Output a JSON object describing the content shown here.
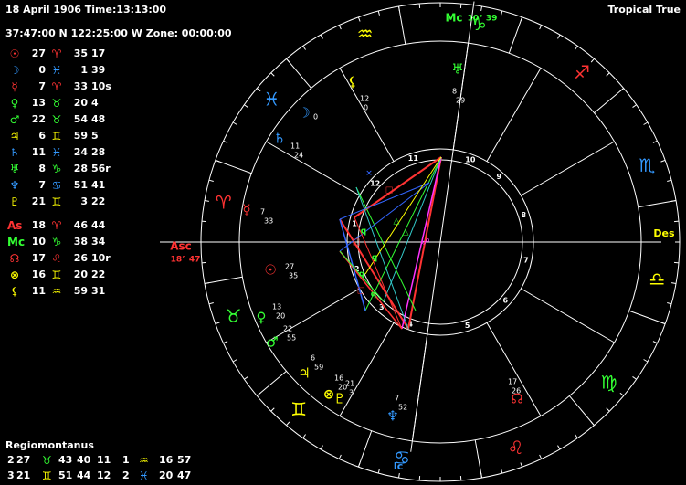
{
  "header": {
    "datetime": "18 April 1906 Time:13:13:00",
    "location": "37:47:00 N 122:25:00 W Zone: 00:00:00",
    "zodiac_mode": "Tropical True"
  },
  "planets": [
    {
      "symbol": "☉",
      "color": "#ff3333",
      "deg": "27",
      "sign": "♈",
      "sign_color": "#ff3333",
      "min": "35",
      "sec": "17"
    },
    {
      "symbol": "☽",
      "color": "#3399ff",
      "deg": "0",
      "sign": "♓",
      "sign_color": "#3399ff",
      "min": "1",
      "sec": "39"
    },
    {
      "symbol": "☿",
      "color": "#ff3333",
      "deg": "7",
      "sign": "♈",
      "sign_color": "#ff3333",
      "min": "33",
      "sec": "10s"
    },
    {
      "symbol": "♀",
      "color": "#33ff33",
      "deg": "13",
      "sign": "♉",
      "sign_color": "#33ff33",
      "min": "20",
      "sec": "4"
    },
    {
      "symbol": "♂",
      "color": "#33ff33",
      "deg": "22",
      "sign": "♉",
      "sign_color": "#33ff33",
      "min": "54",
      "sec": "48"
    },
    {
      "symbol": "♃",
      "color": "#ffff00",
      "deg": "6",
      "sign": "♊",
      "sign_color": "#ffff00",
      "min": "59",
      "sec": "5"
    },
    {
      "symbol": "♄",
      "color": "#3399ff",
      "deg": "11",
      "sign": "♓",
      "sign_color": "#3399ff",
      "min": "24",
      "sec": "28"
    },
    {
      "symbol": "♅",
      "color": "#33ff33",
      "deg": "8",
      "sign": "♑",
      "sign_color": "#33ff33",
      "min": "28",
      "sec": "56r"
    },
    {
      "symbol": "♆",
      "color": "#3399ff",
      "deg": "7",
      "sign": "♋",
      "sign_color": "#3399ff",
      "min": "51",
      "sec": "41"
    },
    {
      "symbol": "♇",
      "color": "#ffff00",
      "deg": "21",
      "sign": "♊",
      "sign_color": "#ffff00",
      "min": "3",
      "sec": "22"
    }
  ],
  "points": [
    {
      "symbol": "As",
      "color": "#ff3333",
      "deg": "18",
      "sign": "♈",
      "sign_color": "#ff3333",
      "min": "46",
      "sec": "44"
    },
    {
      "symbol": "Mc",
      "color": "#33ff33",
      "deg": "10",
      "sign": "♑",
      "sign_color": "#33ff33",
      "min": "38",
      "sec": "34"
    },
    {
      "symbol": "☊",
      "color": "#ff3333",
      "deg": "17",
      "sign": "♌",
      "sign_color": "#ff3333",
      "min": "26",
      "sec": "10r"
    },
    {
      "symbol": "⊗",
      "color": "#ffff00",
      "deg": "16",
      "sign": "♊",
      "sign_color": "#ffff00",
      "min": "20",
      "sec": "22"
    },
    {
      "symbol": "⚸",
      "color": "#ffff00",
      "deg": "11",
      "sign": "♒",
      "sign_color": "#ffff00",
      "min": "59",
      "sec": "31"
    }
  ],
  "houses": {
    "title": "Regiomontanus",
    "rows": [
      {
        "house": "2",
        "deg": "27",
        "sign": "♉",
        "sign_color": "#33ff33",
        "min": "43",
        "sec": "40",
        "house_b": "11",
        "deg_b": "1",
        "sign_b": "♒",
        "sign_b_color": "#ffff00",
        "min_b": "16",
        "sec_b": "57"
      },
      {
        "house": "3",
        "deg": "21",
        "sign": "♊",
        "sign_color": "#ffff00",
        "min": "51",
        "sec": "44",
        "house_b": "12",
        "deg_b": "2",
        "sign_b": "♓",
        "sign_b_color": "#3399ff",
        "min_b": "20",
        "sec_b": "47"
      }
    ]
  },
  "wheel": {
    "angles": {
      "asc": {
        "label": "Asc",
        "pos": "18° 47",
        "color": "#ff3333"
      },
      "mc": {
        "label": "Mc",
        "pos": "10° 39",
        "color": "#33ff33"
      },
      "des": {
        "label": "Des",
        "color": "#ffff00"
      },
      "ic": {
        "label": "Ic",
        "color": "#3399ff"
      }
    },
    "house_numbers": [
      "1",
      "2",
      "3",
      "4",
      "5",
      "6",
      "7",
      "8",
      "9",
      "10",
      "11",
      "12"
    ],
    "signs": [
      {
        "glyph": "♑",
        "color": "#33ff33"
      },
      {
        "glyph": "♒",
        "color": "#ffff00"
      },
      {
        "glyph": "♓",
        "color": "#3399ff"
      },
      {
        "glyph": "♈",
        "color": "#ff3333"
      },
      {
        "glyph": "♉",
        "color": "#33ff33"
      },
      {
        "glyph": "♊",
        "color": "#ffff00"
      },
      {
        "glyph": "♋",
        "color": "#3399ff"
      },
      {
        "glyph": "♌",
        "color": "#ff3333"
      },
      {
        "glyph": "♍",
        "color": "#33ff33"
      },
      {
        "glyph": "♎",
        "color": "#ffff00"
      },
      {
        "glyph": "♏",
        "color": "#3399ff"
      },
      {
        "glyph": "♐",
        "color": "#ff3333"
      }
    ],
    "planet_labels": [
      {
        "glyph": "☉",
        "color": "#ff3333",
        "deg": "27",
        "min": "35"
      },
      {
        "glyph": "☽",
        "color": "#3399ff",
        "deg": "0",
        "min": ""
      },
      {
        "glyph": "☿",
        "color": "#ff3333",
        "deg": "7",
        "min": "33"
      },
      {
        "glyph": "♀",
        "color": "#33ff33",
        "deg": "13",
        "min": "20"
      },
      {
        "glyph": "♂",
        "color": "#33ff33",
        "deg": "22",
        "min": "55"
      },
      {
        "glyph": "♃",
        "color": "#ffff00",
        "deg": "6",
        "min": "59"
      },
      {
        "glyph": "♄",
        "color": "#3399ff",
        "deg": "11",
        "min": "24"
      },
      {
        "glyph": "♅",
        "color": "#33ff33",
        "deg": "8",
        "min": "29"
      },
      {
        "glyph": "♆",
        "color": "#3399ff",
        "deg": "7",
        "min": "52"
      },
      {
        "glyph": "♇",
        "color": "#ffff00",
        "deg": "21",
        "min": "3"
      },
      {
        "glyph": "⊗",
        "color": "#ffff00",
        "deg": "16",
        "min": "20"
      },
      {
        "glyph": "⚸",
        "color": "#ffff00",
        "deg": "12",
        "min": "0"
      },
      {
        "glyph": "☊",
        "color": "#ff3333",
        "deg": "17",
        "min": "26"
      }
    ]
  }
}
